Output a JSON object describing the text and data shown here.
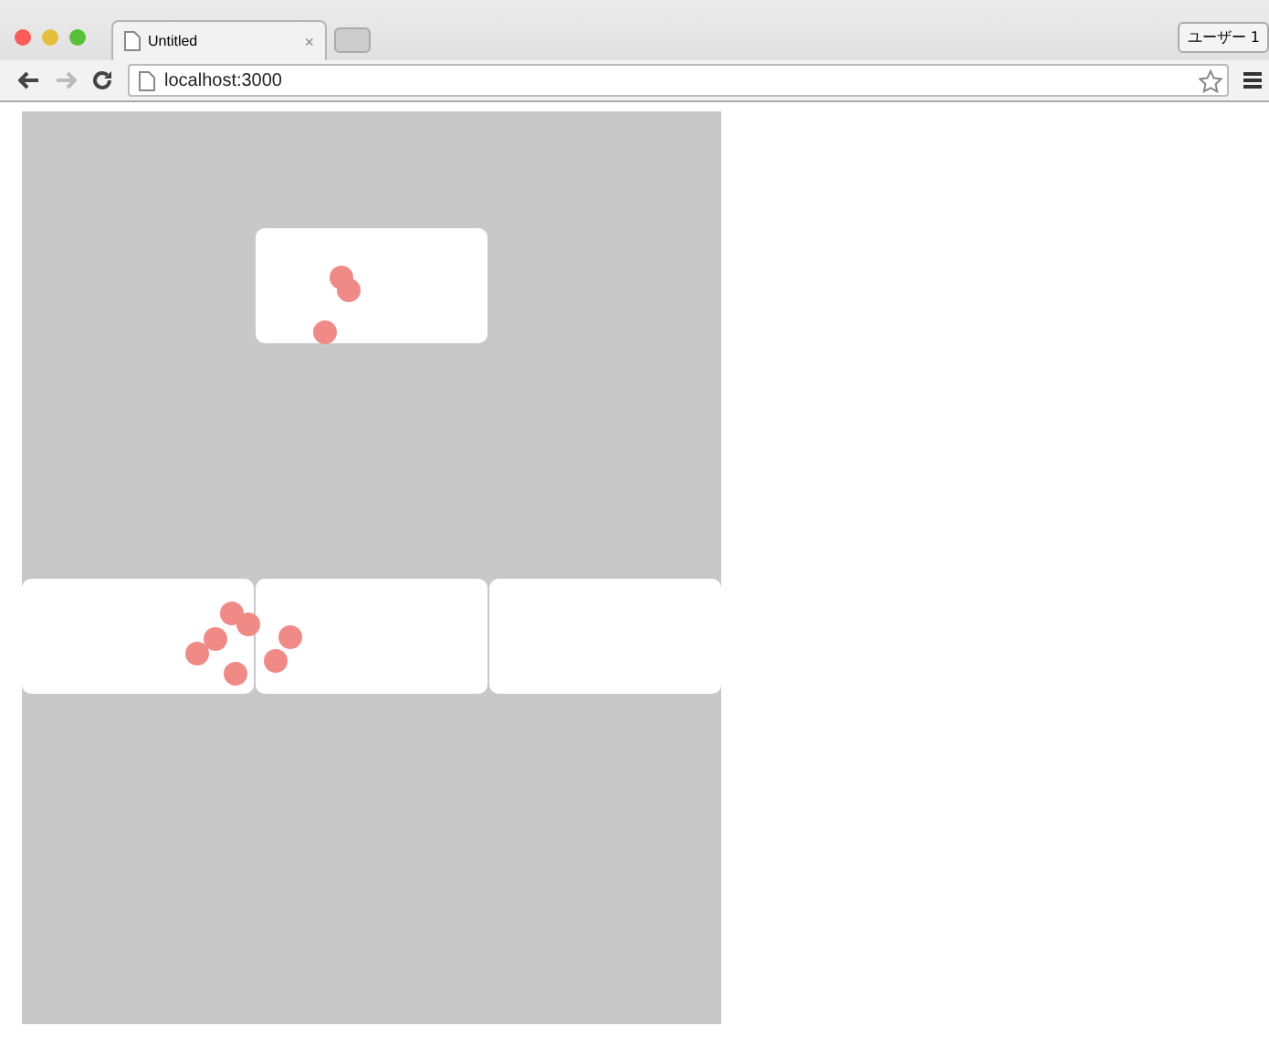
{
  "browser": {
    "tab_title": "Untitled",
    "tab_close": "×",
    "url": "localhost:3000",
    "user_button": "ユーザー 1"
  }
}
